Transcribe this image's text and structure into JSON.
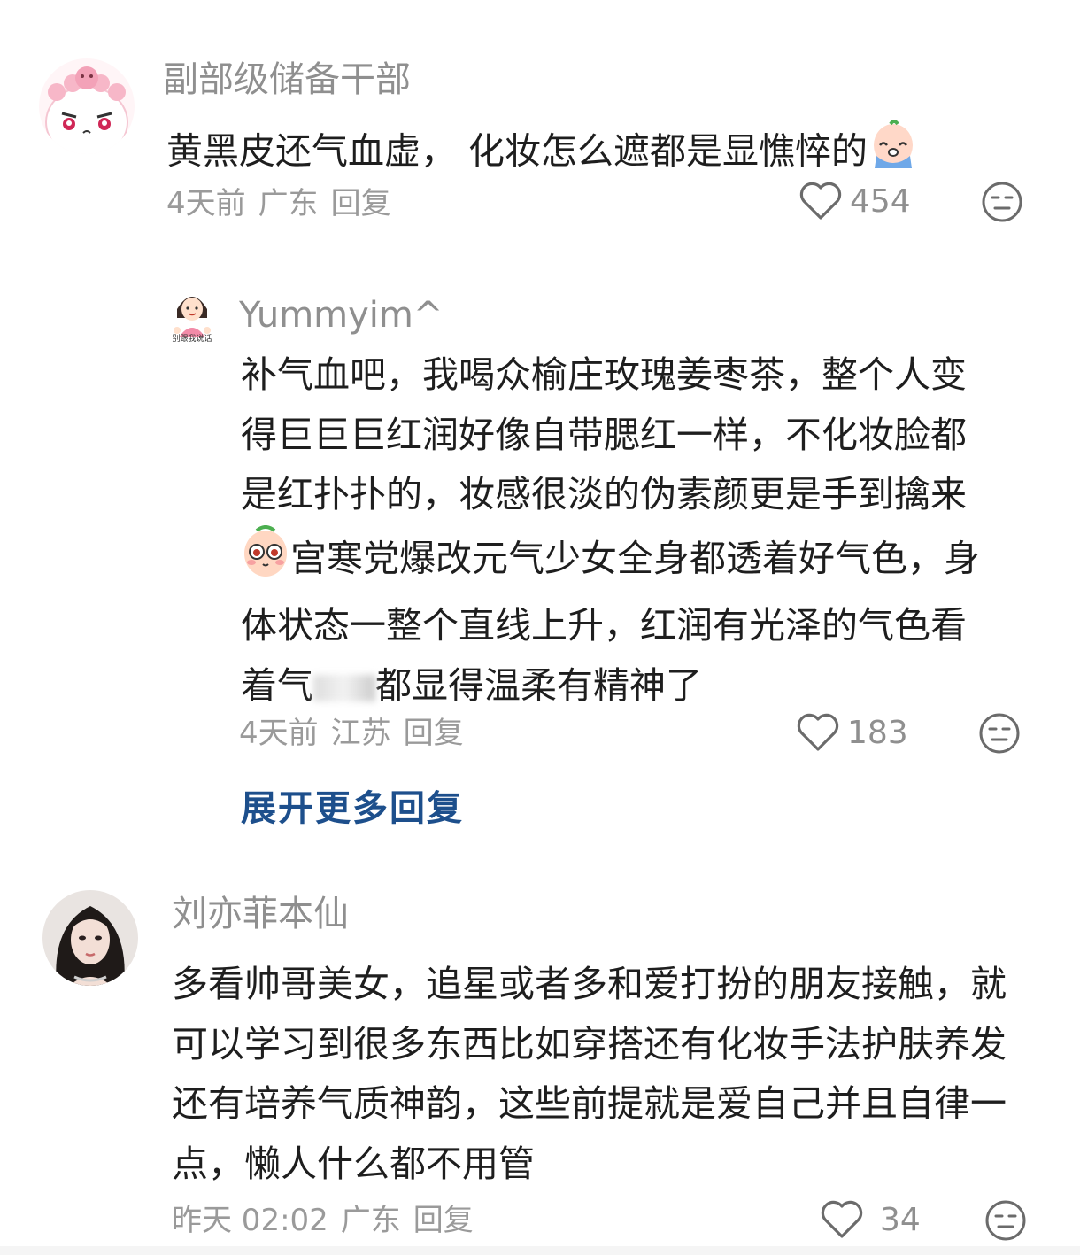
{
  "comments": [
    {
      "username": "副部级储备干部",
      "text": "黄黑皮还气血虚， 化妆怎么遮都是显憔悴的",
      "time": "4天前",
      "location": "广东",
      "reply_label": "回复",
      "likes": "454",
      "emoji_icon": "crying-face-sticker"
    },
    {
      "username": "Yummyim^",
      "avatar_caption": "别跟我说话",
      "text_part1": "补气血吧，我喝众榆庄玫瑰姜枣茶，整个人变得巨巨巨红润好像自带腮红一样，不化妆脸都是红扑扑的，妆感很淡的伪素颜更是手到擒来",
      "text_part2": "宫寒党爆改元气少女全身都透着好气色，身体状态一整个直线上升，红润有光泽的气色看着气",
      "text_part3": "都显得温柔有精神了",
      "time": "4天前",
      "location": "江苏",
      "reply_label": "回复",
      "likes": "183",
      "emoji_icon": "blushing-face-sticker"
    },
    {
      "username": "刘亦菲本仙",
      "text": "多看帅哥美女，追星或者多和爱打扮的朋友接触，就可以学习到很多东西比如穿搭还有化妆手法护肤养发还有培养气质神韵，这些前提就是爱自己并且自律一点，懒人什么都不用管",
      "time": "昨天 02:02",
      "location": "广东",
      "reply_label": "回复",
      "likes": "34"
    }
  ],
  "expand_replies_label": "展开更多回复",
  "colors": {
    "username": "#8f8f8f",
    "body": "#1e1e1e",
    "meta": "#9a9a9a",
    "link": "#1d4f8c"
  }
}
